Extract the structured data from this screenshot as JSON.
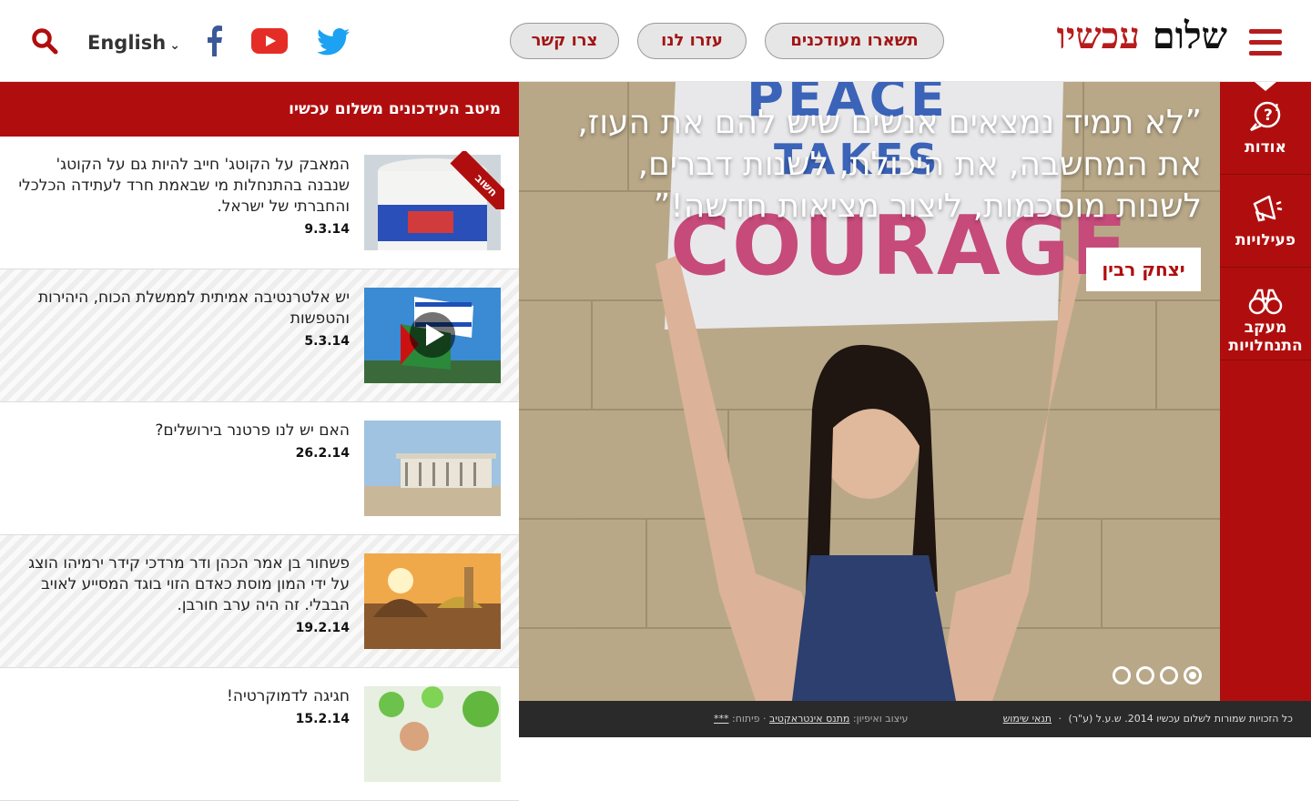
{
  "header": {
    "logo_word1": "שלום",
    "logo_word2": "עכשיו",
    "buttons": {
      "stay_updated": "תשארו מעודכנים",
      "help_us": "עזרו לנו",
      "contact": "צרו קשר"
    },
    "language": "English",
    "icons": [
      "hamburger-menu-icon",
      "twitter-icon",
      "youtube-icon",
      "facebook-icon",
      "chevron-down-icon",
      "search-icon"
    ]
  },
  "feed": {
    "title": "מיטב העידכונים משלום עכשיו",
    "badge": "חשוב",
    "items": [
      {
        "text": "המאבק על הקוטג' חייב להיות גם על הקוטג' שנבנה בהתנחלות מי שבאמת חרד לעתידה הכלכלי והחברתי של ישראל.",
        "date": "9.3.14"
      },
      {
        "text": "יש אלטרנטיבה אמיתית לממשלת הכוח, היהירות והטפשות",
        "date": "5.3.14"
      },
      {
        "text": "האם יש לנו פרטנר בירושלים?",
        "date": "26.2.14"
      },
      {
        "text": "פשחור בן אמר הכהן ודר מרדכי קידר ירמיהו הוצג על ידי המון מוסת כאדם הזוי בוגד המסייע לאויב הבבלי. זה היה ערב חורבן.",
        "date": "19.2.14"
      },
      {
        "text": "חגיגה לדמוקרטיה!",
        "date": "15.2.14"
      }
    ]
  },
  "hero": {
    "sign_line1": "PEACE",
    "sign_line2": "TAKES",
    "sign_line3": "COURAGE",
    "quote": "”לא תמיד נמצאים אנשים שיש להם את העוז, את המחשבה, את היכולת, לשנות דברים, לשנות מוסכמות, ליצור מציאות חדשה!”",
    "author": "יצחק רבין",
    "slides_total": 4,
    "slide_active": 1
  },
  "side_nav": [
    {
      "label": "אודות",
      "icon": "question-bubble-icon"
    },
    {
      "label": "פעילויות",
      "icon": "megaphone-icon"
    },
    {
      "label": "מעקב התנחלויות",
      "icon": "binoculars-icon"
    }
  ],
  "footer": {
    "copyright": "כל הזכויות שמורות לשלום עכשיו 2014. ש.ע.ל (ע\"ר)",
    "sep": "·",
    "terms": "תנאי שימוש",
    "design_label": "עיצוב ואיפיון:",
    "design_link": "מתנס אינטראקטיב",
    "dev_label": "· פיתוח:",
    "dev_link": "***"
  },
  "colors": {
    "brand_red": "#b00e0e",
    "pill_bg": "#e6e6e6",
    "footer_bg": "#2a2a2a"
  }
}
